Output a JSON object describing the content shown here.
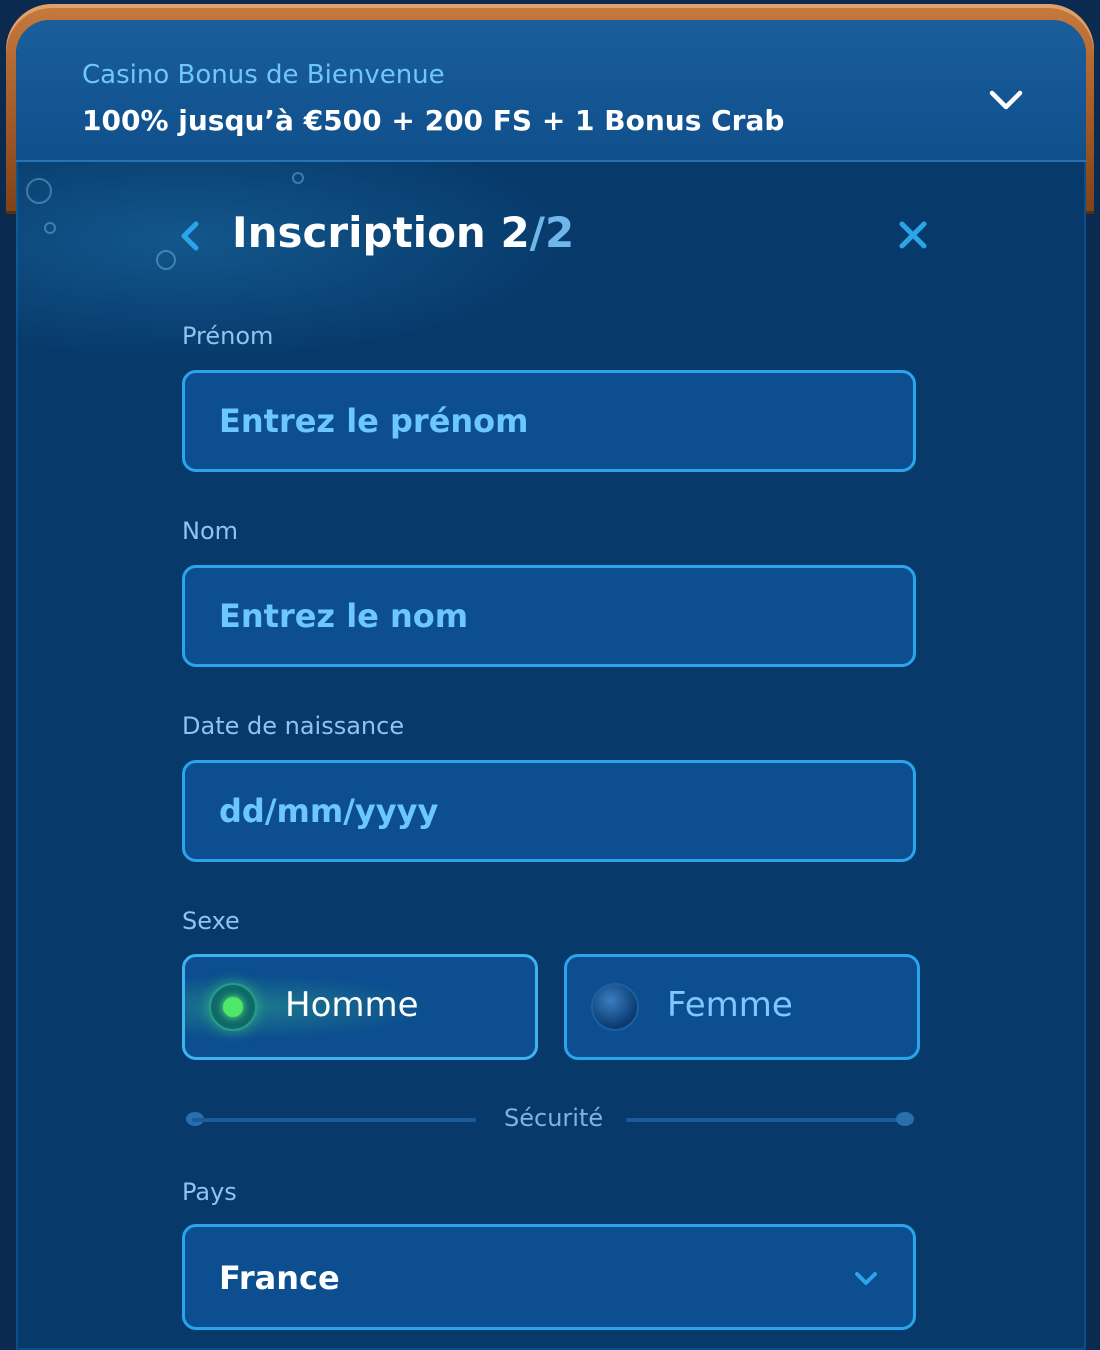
{
  "bonus": {
    "subtitle": "Casino Bonus de Bienvenue",
    "headline": "100% jusqu’à €500 + 200 FS + 1 Bonus Crab",
    "toggle_icon": "chevron-down-icon"
  },
  "header": {
    "title_main": "Inscription 2",
    "title_total": "/2",
    "back_icon": "chevron-left-icon",
    "close_icon": "close-icon"
  },
  "form": {
    "first_name": {
      "label": "Prénom",
      "placeholder": "Entrez le prénom",
      "value": ""
    },
    "last_name": {
      "label": "Nom",
      "placeholder": "Entrez le nom",
      "value": ""
    },
    "birth_date": {
      "label": "Date de naissance",
      "placeholder": "dd/mm/yyyy",
      "value": ""
    },
    "gender": {
      "label": "Sexe",
      "options": [
        {
          "label": "Homme",
          "selected": true
        },
        {
          "label": "Femme",
          "selected": false
        }
      ]
    },
    "section_divider": "Sécurité",
    "country": {
      "label": "Pays",
      "value": "France",
      "icon": "chevron-down-icon"
    }
  },
  "colors": {
    "panel": "#073a6b",
    "field_border": "#2aa4ea",
    "field_bg": "#0c4e8f",
    "placeholder_text": "#6cc7ff",
    "frame_wood": "#a25a27",
    "selected_radio": "#4ee868"
  }
}
